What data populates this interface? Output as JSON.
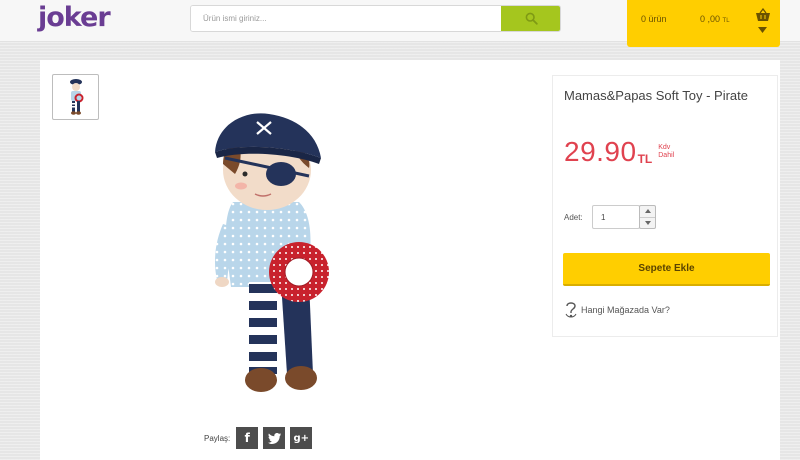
{
  "header": {
    "logo": {
      "text": "joker",
      "brand_color": "#6a3d93",
      "dot_color": "#e3373f"
    },
    "search": {
      "placeholder": "Ürün ismi giriniz...",
      "button_icon": "search-icon",
      "button_color": "#a5c61e"
    },
    "cart": {
      "count_label": "0 ürün",
      "total_value": "0 ,00",
      "total_currency": "TL",
      "icon": "basket-icon",
      "color": "#ffce00"
    }
  },
  "gallery": {
    "thumbnail_icon": "product-thumbnail",
    "product_image_icon": "pirate-soft-toy-image"
  },
  "product": {
    "title": "Mamas&Papas Soft Toy - Pirate",
    "price": "29.90",
    "currency": "TL",
    "tax_note": "Kdv Dahil",
    "price_color": "#e0424f",
    "quantity_label": "Adet",
    "quantity_value": "1",
    "add_to_cart_label": "Sepete Ekle",
    "store_link_label": "Hangi Mağazada Var?"
  },
  "share": {
    "label": "Paylaş:",
    "buttons": [
      {
        "icon": "facebook-icon",
        "glyph": "f"
      },
      {
        "icon": "twitter-icon",
        "glyph": ""
      },
      {
        "icon": "google-plus-icon",
        "glyph": "g+"
      }
    ]
  }
}
